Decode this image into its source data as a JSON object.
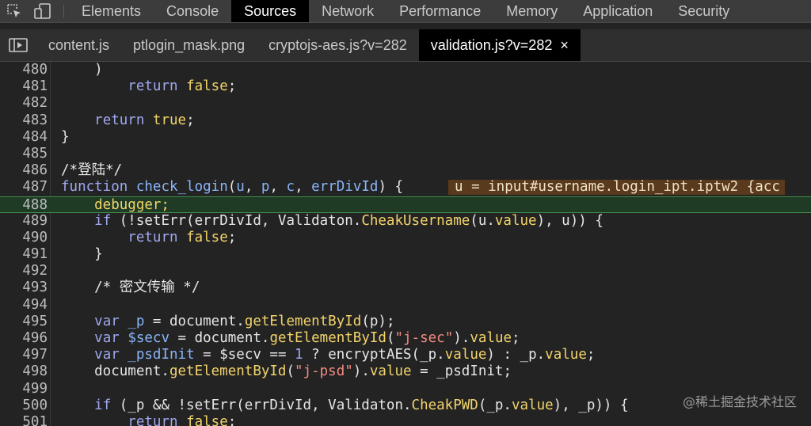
{
  "panel_tabs": [
    "Elements",
    "Console",
    "Sources",
    "Network",
    "Performance",
    "Memory",
    "Application",
    "Security"
  ],
  "active_panel": "Sources",
  "toolbar": {
    "inspect_icon": "inspect-element-icon",
    "device_icon": "device-toolbar-icon"
  },
  "file_tabs": [
    {
      "name": "content.js",
      "active": false
    },
    {
      "name": "ptlogin_mask.png",
      "active": false
    },
    {
      "name": "cryptojs-aes.js?v=282",
      "active": false
    },
    {
      "name": "validation.js?v=282",
      "active": true,
      "close": "×"
    }
  ],
  "editor": {
    "paused_line": 488,
    "inline_value": "u = input#username.login_ipt.iptw2 {acc",
    "lines": [
      {
        "n": "480",
        "tokens": [
          [
            "    )",
            "#e6e6e6"
          ]
        ]
      },
      {
        "n": "481",
        "tokens": [
          [
            "        ",
            "#e6e6e6"
          ],
          [
            "return",
            "#9fa8f0"
          ],
          [
            " ",
            "#e6e6e6"
          ],
          [
            "false",
            "#f2d46b"
          ],
          [
            ";",
            "#e6e6e6"
          ]
        ]
      },
      {
        "n": "482",
        "tokens": []
      },
      {
        "n": "483",
        "tokens": [
          [
            "    ",
            "#e6e6e6"
          ],
          [
            "return",
            "#9fa8f0"
          ],
          [
            " ",
            "#e6e6e6"
          ],
          [
            "true",
            "#f2d46b"
          ],
          [
            ";",
            "#e6e6e6"
          ]
        ]
      },
      {
        "n": "484",
        "tokens": [
          [
            "}",
            "#e6e6e6"
          ]
        ]
      },
      {
        "n": "485",
        "tokens": []
      },
      {
        "n": "486",
        "tokens": [
          [
            "/*登陆*/",
            "#e6e6e6"
          ]
        ]
      },
      {
        "n": "487",
        "tokens": [
          [
            "function",
            "#9fa8f0"
          ],
          [
            " ",
            "#e6e6e6"
          ],
          [
            "check_login",
            "#8ab4f8"
          ],
          [
            "(",
            "#e6e6e6"
          ],
          [
            "u",
            "#8ab4f8"
          ],
          [
            ", ",
            "#e6e6e6"
          ],
          [
            "p",
            "#8ab4f8"
          ],
          [
            ", ",
            "#e6e6e6"
          ],
          [
            "c",
            "#8ab4f8"
          ],
          [
            ", ",
            "#e6e6e6"
          ],
          [
            "errDivId",
            "#8ab4f8"
          ],
          [
            ") {",
            "#e6e6e6"
          ]
        ]
      },
      {
        "n": "488",
        "tokens": [
          [
            "    debugger;",
            "#f2d46b"
          ]
        ]
      },
      {
        "n": "489",
        "tokens": [
          [
            "    ",
            "#e6e6e6"
          ],
          [
            "if",
            "#9fa8f0"
          ],
          [
            " (!setErr(errDivId, Validaton.",
            "#e6e6e6"
          ],
          [
            "CheakUsername",
            "#f2d46b"
          ],
          [
            "(u.",
            "#e6e6e6"
          ],
          [
            "value",
            "#f2d46b"
          ],
          [
            "), u)) {",
            "#e6e6e6"
          ]
        ]
      },
      {
        "n": "490",
        "tokens": [
          [
            "        ",
            "#e6e6e6"
          ],
          [
            "return",
            "#9fa8f0"
          ],
          [
            " ",
            "#e6e6e6"
          ],
          [
            "false",
            "#f2d46b"
          ],
          [
            ";",
            "#e6e6e6"
          ]
        ]
      },
      {
        "n": "491",
        "tokens": [
          [
            "    }",
            "#e6e6e6"
          ]
        ]
      },
      {
        "n": "492",
        "tokens": []
      },
      {
        "n": "493",
        "tokens": [
          [
            "    /* 密文传输 */",
            "#e6e6e6"
          ]
        ]
      },
      {
        "n": "494",
        "tokens": []
      },
      {
        "n": "495",
        "tokens": [
          [
            "    ",
            "#e6e6e6"
          ],
          [
            "var",
            "#9fa8f0"
          ],
          [
            " ",
            "#e6e6e6"
          ],
          [
            "_p",
            "#8ab4f8"
          ],
          [
            " = document.",
            "#e6e6e6"
          ],
          [
            "getElementById",
            "#f2d46b"
          ],
          [
            "(p);",
            "#e6e6e6"
          ]
        ]
      },
      {
        "n": "496",
        "tokens": [
          [
            "    ",
            "#e6e6e6"
          ],
          [
            "var",
            "#9fa8f0"
          ],
          [
            " ",
            "#e6e6e6"
          ],
          [
            "$secv",
            "#8ab4f8"
          ],
          [
            " = document.",
            "#e6e6e6"
          ],
          [
            "getElementById",
            "#f2d46b"
          ],
          [
            "(",
            "#e6e6e6"
          ],
          [
            "\"j-sec\"",
            "#f28b82"
          ],
          [
            ").",
            "#e6e6e6"
          ],
          [
            "value",
            "#f2d46b"
          ],
          [
            ";",
            "#e6e6e6"
          ]
        ]
      },
      {
        "n": "497",
        "tokens": [
          [
            "    ",
            "#e6e6e6"
          ],
          [
            "var",
            "#9fa8f0"
          ],
          [
            " ",
            "#e6e6e6"
          ],
          [
            "_psdInit",
            "#8ab4f8"
          ],
          [
            " = $secv == ",
            "#e6e6e6"
          ],
          [
            "1",
            "#9fa8f0"
          ],
          [
            " ? encryptAES(_p.",
            "#e6e6e6"
          ],
          [
            "value",
            "#f2d46b"
          ],
          [
            ") : _p.",
            "#e6e6e6"
          ],
          [
            "value",
            "#f2d46b"
          ],
          [
            ";",
            "#e6e6e6"
          ]
        ]
      },
      {
        "n": "498",
        "tokens": [
          [
            "    document.",
            "#e6e6e6"
          ],
          [
            "getElementById",
            "#f2d46b"
          ],
          [
            "(",
            "#e6e6e6"
          ],
          [
            "\"j-psd\"",
            "#f28b82"
          ],
          [
            ").",
            "#e6e6e6"
          ],
          [
            "value",
            "#f2d46b"
          ],
          [
            " = _psdInit;",
            "#e6e6e6"
          ]
        ]
      },
      {
        "n": "499",
        "tokens": []
      },
      {
        "n": "500",
        "tokens": [
          [
            "    ",
            "#e6e6e6"
          ],
          [
            "if",
            "#9fa8f0"
          ],
          [
            " (_p && !setErr(errDivId, Validaton.",
            "#e6e6e6"
          ],
          [
            "CheakPWD",
            "#f2d46b"
          ],
          [
            "(_p.",
            "#e6e6e6"
          ],
          [
            "value",
            "#f2d46b"
          ],
          [
            "), _p)) {",
            "#e6e6e6"
          ]
        ]
      },
      {
        "n": "501",
        "tokens": [
          [
            "        ",
            "#e6e6e6"
          ],
          [
            "return",
            "#9fa8f0"
          ],
          [
            " ",
            "#e6e6e6"
          ],
          [
            "false",
            "#f2d46b"
          ],
          [
            ";",
            "#e6e6e6"
          ]
        ]
      }
    ]
  },
  "watermark": "@稀土掘金技术社区"
}
